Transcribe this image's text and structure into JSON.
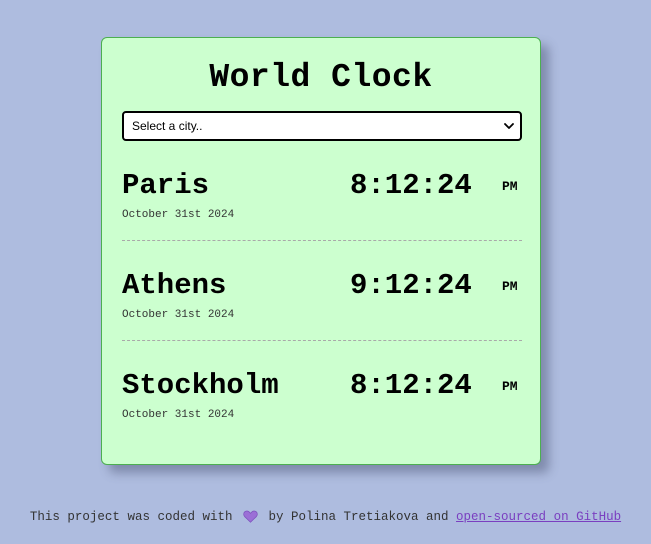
{
  "app": {
    "title": "World Clock"
  },
  "city_select": {
    "placeholder": "Select a city.."
  },
  "cities": [
    {
      "name": "Paris",
      "date": "October 31st 2024",
      "time": "8:12:24",
      "ampm": "PM"
    },
    {
      "name": "Athens",
      "date": "October 31st 2024",
      "time": "9:12:24",
      "ampm": "PM"
    },
    {
      "name": "Stockholm",
      "date": "October 31st 2024",
      "time": "8:12:24",
      "ampm": "PM"
    }
  ],
  "footer": {
    "text_before": "This project was coded with",
    "heart_icon": "heart-icon",
    "text_middle": "by Polina Tretiakova and",
    "link_text": "open-sourced on GitHub"
  },
  "colors": {
    "page_background": "#aebcdf",
    "card_background": "#ccffcf",
    "card_border": "#4caf50",
    "heart": "#9b6fd6",
    "link": "#7a3fc0"
  }
}
